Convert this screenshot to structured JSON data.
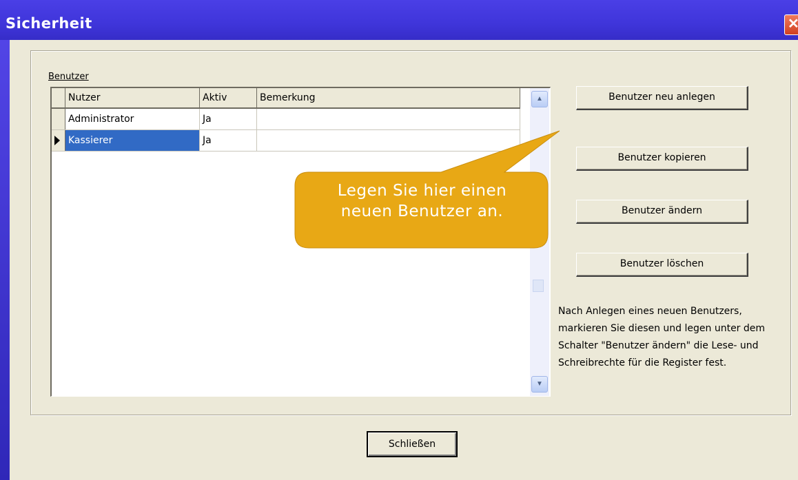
{
  "window": {
    "title": "Sicherheit",
    "close_glyph": "✕"
  },
  "users_group": {
    "label": "Benutzer",
    "columns": [
      "Nutzer",
      "Aktiv",
      "Bemerkung"
    ],
    "rows": [
      {
        "nutzer": "Administrator",
        "aktiv": "Ja",
        "bemerkung": ""
      },
      {
        "nutzer": "Kassierer",
        "aktiv": "Ja",
        "bemerkung": "",
        "selected": true
      }
    ]
  },
  "buttons": {
    "new_user": "Benutzer neu anlegen",
    "copy_user": "Benutzer kopieren",
    "edit_user": "Benutzer ändern",
    "delete_user": "Benutzer löschen",
    "close": "Schließen"
  },
  "info_text": "Nach Anlegen eines neuen Benutzers, markieren Sie diesen und legen unter dem Schalter \"Benutzer ändern\" die Lese- und Schreibrechte für die Register fest.",
  "callout": {
    "text_line1": "Legen Sie hier einen",
    "text_line2": "neuen Benutzer an.",
    "color": "#e8a815"
  },
  "colors": {
    "selection": "#316ac5",
    "dialog_background": "#ece9d8",
    "titlebar": "#3f35da"
  }
}
